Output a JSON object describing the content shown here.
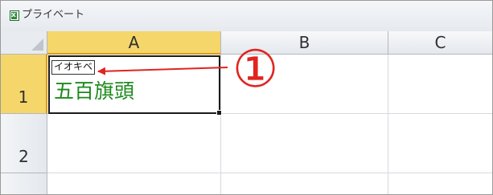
{
  "window": {
    "app_icon": "excel-icon",
    "title": "プライベート"
  },
  "sheet": {
    "columns": [
      "A",
      "B",
      "C"
    ],
    "rows": [
      "1",
      "2"
    ],
    "selected_cell": "A1",
    "cell_a1": {
      "phonetic": "イオキベ",
      "value": "五百旗頭",
      "text_color": "#1d8a1d"
    }
  },
  "annotation": {
    "label": "①",
    "color": "#e0241f"
  }
}
